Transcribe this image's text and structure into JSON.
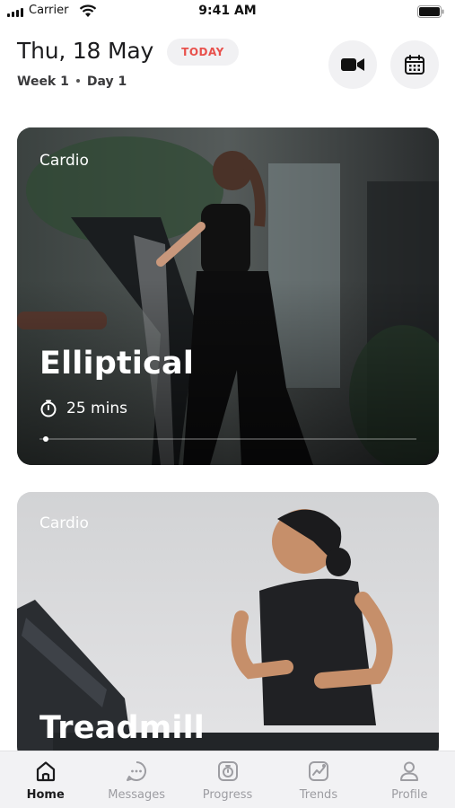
{
  "status_bar": {
    "carrier": "Carrier",
    "time": "9:41 AM"
  },
  "header": {
    "date": "Thu, 18 May",
    "today_badge": "TODAY",
    "week": "Week 1",
    "day": "Day 1",
    "buttons": [
      {
        "icon": "video-camera-icon"
      },
      {
        "icon": "calendar-icon"
      }
    ]
  },
  "workouts": [
    {
      "category": "Cardio",
      "title": "Elliptical",
      "duration": "25 mins",
      "progress": 0.01
    },
    {
      "category": "Cardio",
      "title": "Treadmill"
    }
  ],
  "tabs": [
    {
      "label": "Home",
      "icon": "home-icon",
      "active": true
    },
    {
      "label": "Messages",
      "icon": "messages-icon",
      "active": false
    },
    {
      "label": "Progress",
      "icon": "progress-icon",
      "active": false
    },
    {
      "label": "Trends",
      "icon": "trends-icon",
      "active": false
    },
    {
      "label": "Profile",
      "icon": "profile-icon",
      "active": false
    }
  ],
  "colors": {
    "accent": "#e8514c",
    "active_tab": "#1c1c1e",
    "inactive_tab": "#9d9da2"
  }
}
